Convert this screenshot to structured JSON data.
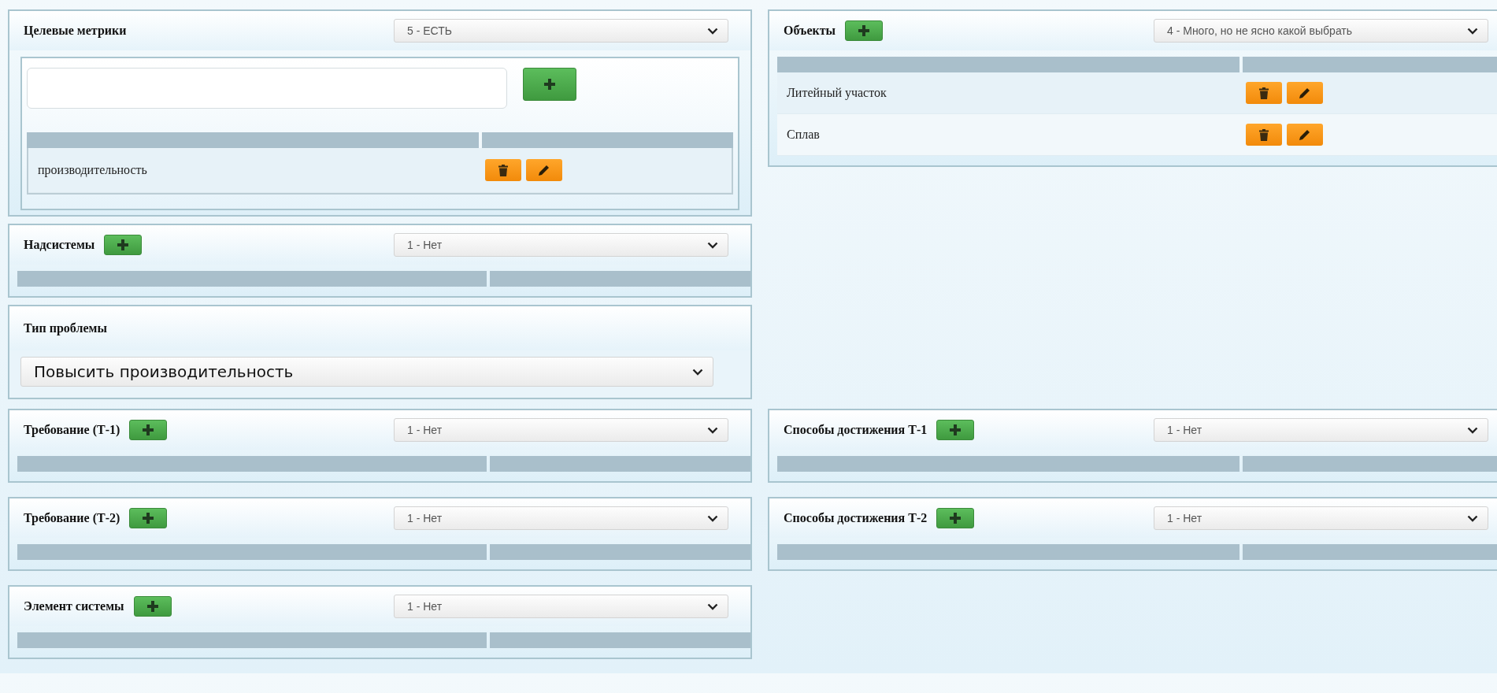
{
  "sections": [
    {
      "left": [
        {
          "kind": "metrics",
          "title": "Целевые метрики",
          "add": false,
          "select": "5 - ЕСТЬ",
          "rows": [
            "производительность"
          ]
        },
        {
          "kind": "list",
          "title": "Надсистемы",
          "add": true,
          "select": "1 - Нет"
        },
        {
          "kind": "problem",
          "title": "Тип проблемы",
          "select": "Повысить производительность"
        }
      ],
      "right": [
        {
          "kind": "list",
          "title": "Объекты",
          "add": true,
          "select": "4 - Много, но не ясно какой выбрать",
          "rows": [
            "Литейный участок",
            "Сплав"
          ]
        }
      ]
    },
    {
      "left": [
        {
          "kind": "list",
          "title": "Требование (Т-1)",
          "add": true,
          "select": "1 - Нет"
        }
      ],
      "right": [
        {
          "kind": "list",
          "title": "Способы достижения Т-1",
          "add": true,
          "select": "1 - Нет"
        }
      ]
    },
    {
      "left": [
        {
          "kind": "list",
          "title": "Требование (Т-2)",
          "add": true,
          "select": "1 - Нет"
        }
      ],
      "right": [
        {
          "kind": "list",
          "title": "Способы достижения Т-2",
          "add": true,
          "select": "1 - Нет"
        }
      ]
    },
    {
      "left": [
        {
          "kind": "list",
          "title": "Элемент системы",
          "add": true,
          "select": "1 - Нет"
        }
      ]
    }
  ]
}
